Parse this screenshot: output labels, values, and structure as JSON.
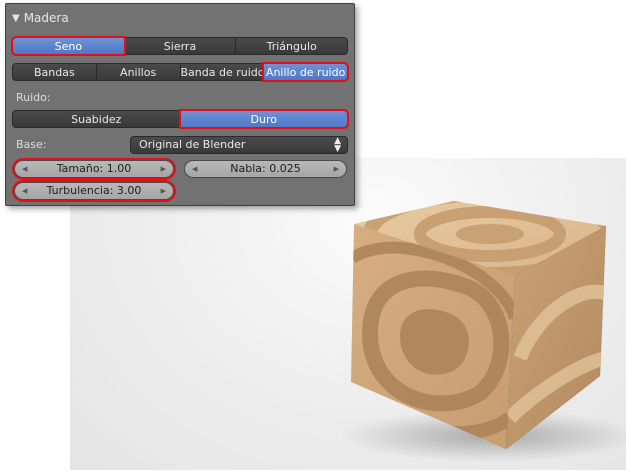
{
  "panel": {
    "title": "Madera",
    "wave_buttons": [
      {
        "label": "Seno",
        "active": true
      },
      {
        "label": "Sierra",
        "active": false
      },
      {
        "label": "Triángulo",
        "active": false
      }
    ],
    "type_buttons": [
      {
        "label": "Bandas",
        "active": false
      },
      {
        "label": "Anillos",
        "active": false
      },
      {
        "label": "Banda de ruido",
        "active": false
      },
      {
        "label": "Anillo de ruido",
        "active": true
      }
    ],
    "noise_label": "Ruido:",
    "noise_buttons": [
      {
        "label": "Suabidez",
        "active": false
      },
      {
        "label": "Duro",
        "active": true
      }
    ],
    "basis_label": "Base:",
    "basis_value": "Original de Blender",
    "size_field": "Tamaño: 1.00",
    "nabla_field": "Nabla: 0.025",
    "turbulence_field": "Turbulencia: 3.00"
  },
  "colors": {
    "panel_bg": "#727272",
    "active_blue": "#5e86d0",
    "highlight_red": "#e30f18",
    "wood_light": "#e3c49a",
    "wood_dark": "#b98f62"
  },
  "icons": {
    "collapse": "triangle-down",
    "select_arrows": "up-down-arrows",
    "field_decrement": "arrow-left",
    "field_increment": "arrow-right"
  }
}
